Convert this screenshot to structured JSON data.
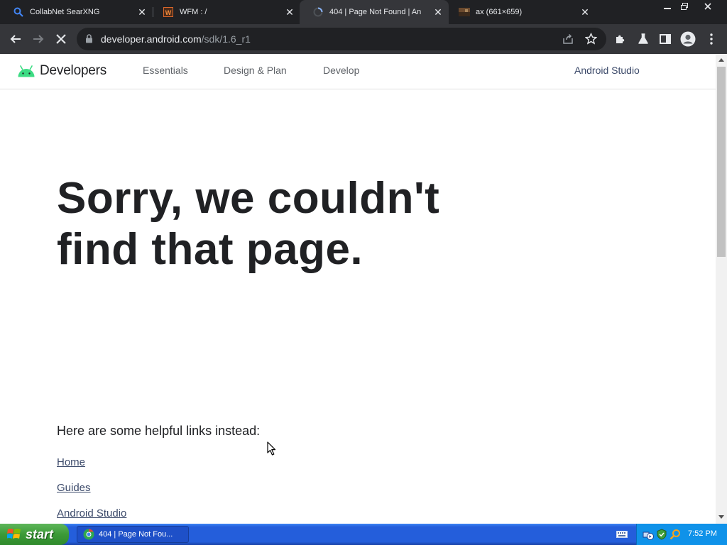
{
  "browser": {
    "tabs": [
      {
        "title": "CollabNet SearXNG",
        "active": false,
        "favicon": "search-icon"
      },
      {
        "title": "WFM : /",
        "active": false,
        "favicon": "wfm-icon"
      },
      {
        "title": "404 | Page Not Found | An",
        "active": true,
        "favicon": "loading-spinner-icon"
      },
      {
        "title": "ax (661×659)",
        "active": false,
        "favicon": "image-icon"
      }
    ],
    "url_host": "developer.android.com",
    "url_path": "/sdk/1.6_r1"
  },
  "site": {
    "logo_text": "Developers",
    "nav": [
      "Essentials",
      "Design & Plan",
      "Develop"
    ],
    "nav_right": "Android Studio"
  },
  "content": {
    "headline": "Sorry, we couldn't find that page.",
    "helpful_text": "Here are some helpful links instead:",
    "links": [
      "Home",
      "Guides",
      "Android Studio"
    ]
  },
  "taskbar": {
    "start_label": "start",
    "task_title": "404 | Page Not Fou...",
    "clock": "7:52 PM"
  },
  "colors": {
    "android_green": "#3ddc84",
    "link": "#3c4a6a",
    "chrome_dark": "#202124",
    "chrome_toolbar": "#35363a"
  }
}
